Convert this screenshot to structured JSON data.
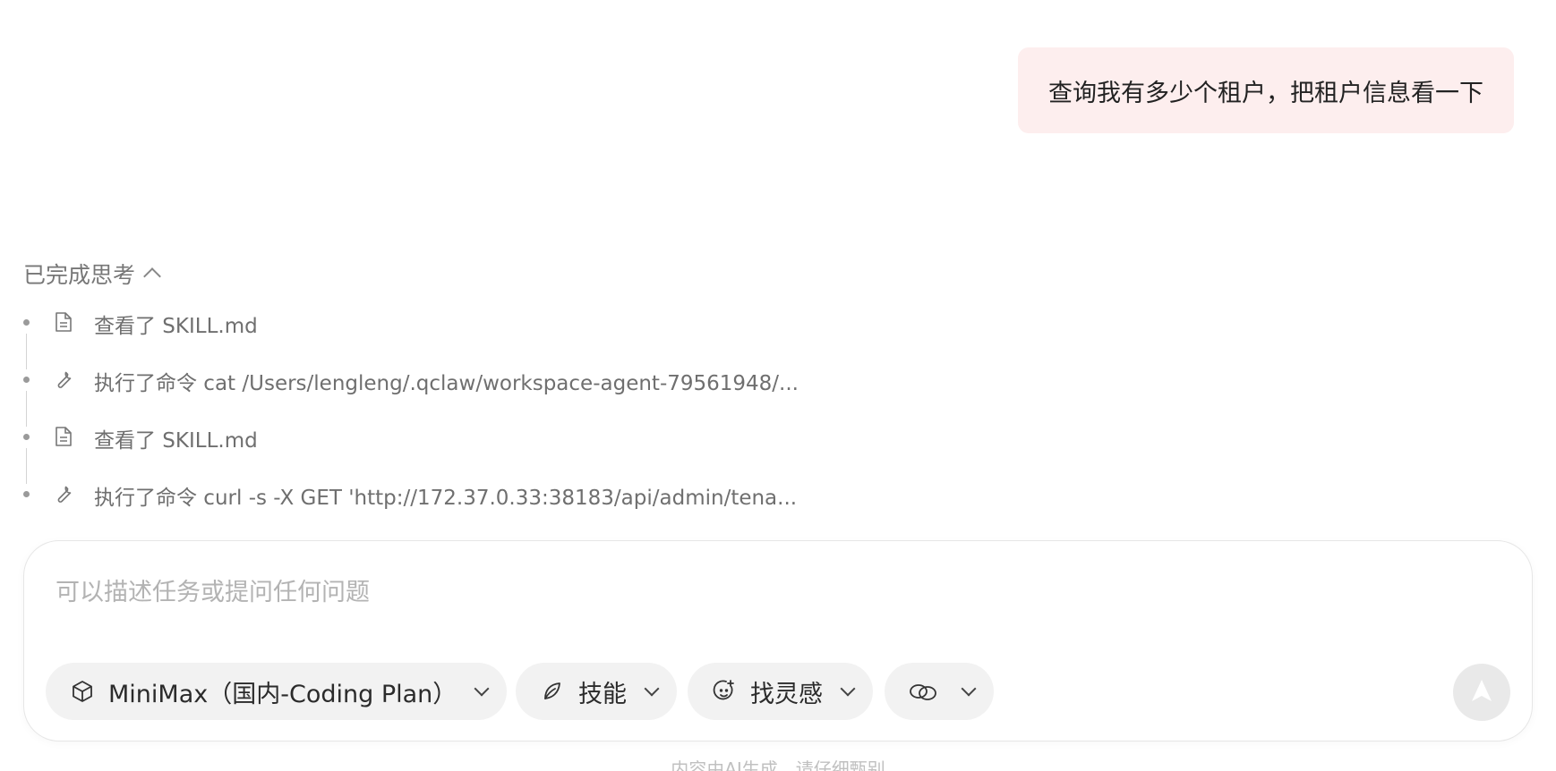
{
  "user_message": {
    "text": "查询我有多少个租户，把租户信息看一下"
  },
  "thinking": {
    "header_label": "已完成思考",
    "steps": [
      {
        "icon": "document-icon",
        "label": "查看了 SKILL.md"
      },
      {
        "icon": "wrench-icon",
        "label": "执行了命令 cat /Users/lengleng/.qclaw/workspace-agent-79561948/..."
      },
      {
        "icon": "document-icon",
        "label": "查看了 SKILL.md"
      },
      {
        "icon": "wrench-icon",
        "label": "执行了命令 curl -s -X GET 'http://172.37.0.33:38183/api/admin/tena..."
      }
    ]
  },
  "composer": {
    "placeholder": "可以描述任务或提问任何问题",
    "value": "",
    "model_label": "MiniMax（国内-Coding Plan）",
    "skills_label": "技能",
    "inspiration_label": "找灵感",
    "link_icon": "link-icon",
    "send_icon": "send-arrow-icon"
  },
  "footer": {
    "note": "内容由AI生成，请仔细甄别"
  },
  "colors": {
    "user_bubble_bg": "#fdeeee",
    "pill_bg": "#f2f2f2",
    "muted_text": "#6f6f6f"
  }
}
